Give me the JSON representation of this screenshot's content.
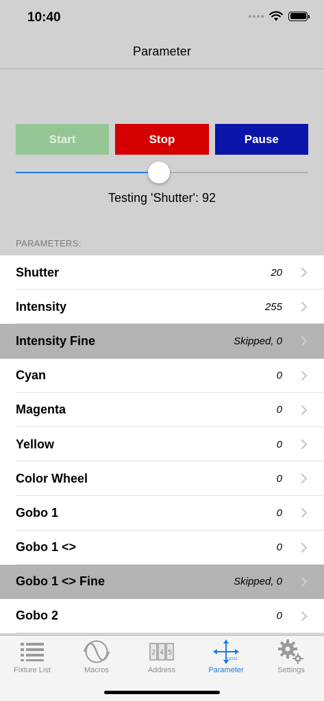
{
  "status_bar": {
    "time": "10:40"
  },
  "nav": {
    "title": "Parameter"
  },
  "controls": {
    "start_label": "Start",
    "stop_label": "Stop",
    "pause_label": "Pause",
    "slider_fraction": 0.49
  },
  "testing_label": "Testing 'Shutter': 92",
  "section_header": "PARAMETERS:",
  "parameters": [
    {
      "name": "Shutter",
      "value": "20",
      "skipped": false
    },
    {
      "name": "Intensity",
      "value": "255",
      "skipped": false
    },
    {
      "name": "Intensity Fine",
      "value": "Skipped, 0",
      "skipped": true
    },
    {
      "name": "Cyan",
      "value": "0",
      "skipped": false
    },
    {
      "name": "Magenta",
      "value": "0",
      "skipped": false
    },
    {
      "name": "Yellow",
      "value": "0",
      "skipped": false
    },
    {
      "name": "Color Wheel",
      "value": "0",
      "skipped": false
    },
    {
      "name": "Gobo 1",
      "value": "0",
      "skipped": false
    },
    {
      "name": "Gobo 1 <>",
      "value": "0",
      "skipped": false
    },
    {
      "name": "Gobo 1 <> Fine",
      "value": "Skipped, 0",
      "skipped": true
    },
    {
      "name": "Gobo 2",
      "value": "0",
      "skipped": false
    }
  ],
  "tabs": [
    {
      "label": "Fixture List",
      "icon": "list-icon",
      "active": false
    },
    {
      "label": "Macros",
      "icon": "sine-wave-icon",
      "active": false
    },
    {
      "label": "Address",
      "icon": "address-counter-icon",
      "active": false
    },
    {
      "label": "Parameter",
      "icon": "move-arrows-icon",
      "active": true
    },
    {
      "label": "Settings",
      "icon": "gears-icon",
      "active": false
    }
  ],
  "colors": {
    "start": "#94c594",
    "stop": "#d40000",
    "pause": "#0a14a8",
    "accent": "#1a7cf0",
    "skipped_row": "#b3b3b3"
  }
}
